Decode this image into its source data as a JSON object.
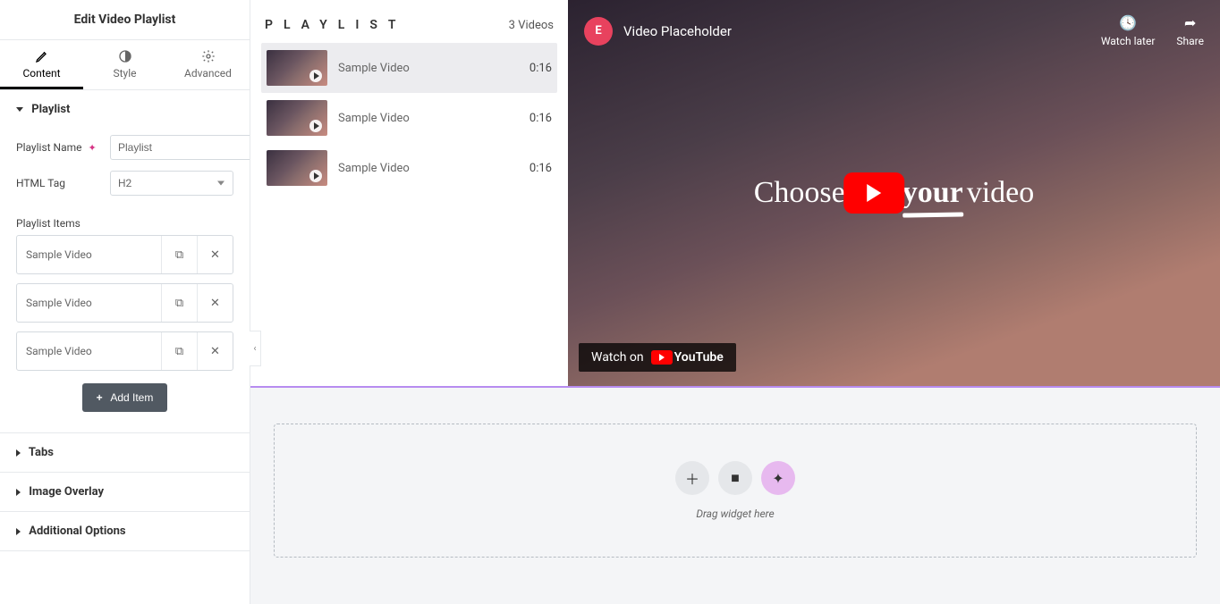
{
  "sidebar": {
    "title": "Edit Video Playlist",
    "tabs": {
      "content": "Content",
      "style": "Style",
      "advanced": "Advanced"
    },
    "section_playlist": "Playlist",
    "playlist_name_label": "Playlist Name",
    "playlist_name_value": "Playlist",
    "html_tag_label": "HTML Tag",
    "html_tag_value": "H2",
    "playlist_items_label": "Playlist Items",
    "items": [
      {
        "title": "Sample Video"
      },
      {
        "title": "Sample Video"
      },
      {
        "title": "Sample Video"
      }
    ],
    "add_item": "Add Item",
    "section_tabs_label": "Tabs",
    "section_image_overlay": "Image Overlay",
    "section_additional": "Additional Options"
  },
  "playlist": {
    "heading": "PLAYLIST",
    "count": "3 Videos",
    "items": [
      {
        "name": "Sample Video",
        "duration": "0:16"
      },
      {
        "name": "Sample Video",
        "duration": "0:16"
      },
      {
        "name": "Sample Video",
        "duration": "0:16"
      }
    ]
  },
  "video": {
    "title": "Video Placeholder",
    "watch_later": "Watch later",
    "share": "Share",
    "choose_left": "Choose ",
    "your": "your",
    "video_word": " video",
    "watch_on": "Watch on",
    "youtube": "YouTube"
  },
  "dropzone": {
    "text": "Drag widget here"
  }
}
